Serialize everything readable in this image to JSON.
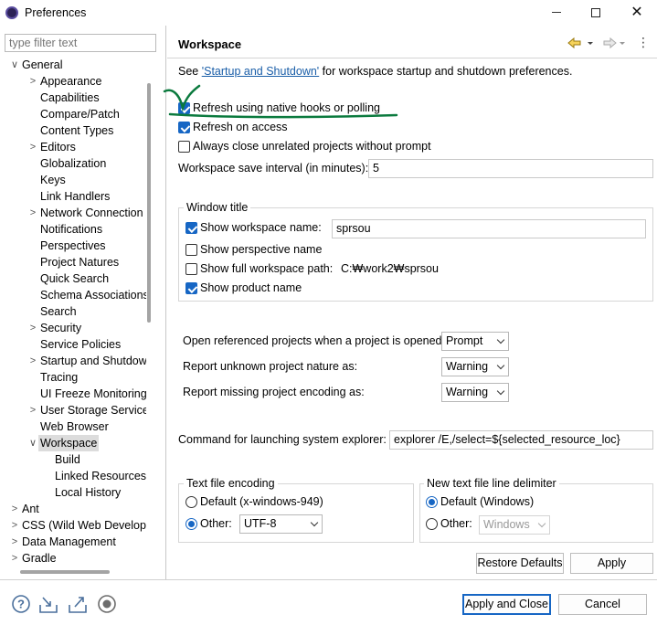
{
  "window": {
    "title": "Preferences",
    "controls": [
      "minimize",
      "maximize",
      "close"
    ]
  },
  "left": {
    "filter_placeholder": "type filter text",
    "tree": [
      {
        "label": "General",
        "twisty": "open",
        "level": 0
      },
      {
        "label": "Appearance",
        "twisty": "closed",
        "level": 1
      },
      {
        "label": "Capabilities",
        "twisty": "",
        "level": 1
      },
      {
        "label": "Compare/Patch",
        "twisty": "",
        "level": 1
      },
      {
        "label": "Content Types",
        "twisty": "",
        "level": 1
      },
      {
        "label": "Editors",
        "twisty": "closed",
        "level": 1
      },
      {
        "label": "Globalization",
        "twisty": "",
        "level": 1
      },
      {
        "label": "Keys",
        "twisty": "",
        "level": 1
      },
      {
        "label": "Link Handlers",
        "twisty": "",
        "level": 1
      },
      {
        "label": "Network Connection",
        "twisty": "closed",
        "level": 1
      },
      {
        "label": "Notifications",
        "twisty": "",
        "level": 1
      },
      {
        "label": "Perspectives",
        "twisty": "",
        "level": 1
      },
      {
        "label": "Project Natures",
        "twisty": "",
        "level": 1
      },
      {
        "label": "Quick Search",
        "twisty": "",
        "level": 1
      },
      {
        "label": "Schema Associations",
        "twisty": "",
        "level": 1
      },
      {
        "label": "Search",
        "twisty": "",
        "level": 1
      },
      {
        "label": "Security",
        "twisty": "closed",
        "level": 1
      },
      {
        "label": "Service Policies",
        "twisty": "",
        "level": 1
      },
      {
        "label": "Startup and Shutdow",
        "twisty": "closed",
        "level": 1
      },
      {
        "label": "Tracing",
        "twisty": "",
        "level": 1
      },
      {
        "label": "UI Freeze Monitoring",
        "twisty": "",
        "level": 1
      },
      {
        "label": "User Storage Service",
        "twisty": "closed",
        "level": 1
      },
      {
        "label": "Web Browser",
        "twisty": "",
        "level": 1
      },
      {
        "label": "Workspace",
        "twisty": "open",
        "level": 1,
        "selected": true
      },
      {
        "label": "Build",
        "twisty": "",
        "level": 2
      },
      {
        "label": "Linked Resources",
        "twisty": "",
        "level": 2
      },
      {
        "label": "Local History",
        "twisty": "",
        "level": 2
      },
      {
        "label": "Ant",
        "twisty": "closed",
        "level": 0
      },
      {
        "label": "CSS (Wild Web Develop",
        "twisty": "closed",
        "level": 0
      },
      {
        "label": "Data Management",
        "twisty": "closed",
        "level": 0
      },
      {
        "label": "Gradle",
        "twisty": "closed",
        "level": 0
      }
    ]
  },
  "page": {
    "title": "Workspace",
    "intro_prefix": "See ",
    "intro_link": "'Startup and Shutdown'",
    "intro_suffix": " for workspace startup and shutdown preferences.",
    "refresh_native": {
      "label": "Refresh using native hooks or polling",
      "checked": true
    },
    "refresh_access": {
      "label": "Refresh on access",
      "checked": true
    },
    "always_close": {
      "label": "Always close unrelated projects without prompt",
      "checked": false
    },
    "save_interval": {
      "label": "Workspace save interval (in minutes):",
      "value": "5"
    },
    "window_title": {
      "group_label": "Window title",
      "show_workspace_name": {
        "label": "Show workspace name:",
        "checked": true,
        "value": "sprsou"
      },
      "show_perspective_name": {
        "label": "Show perspective name",
        "checked": false
      },
      "show_full_path": {
        "label": "Show full workspace path:",
        "checked": false,
        "value": "C:₩work2₩sprsou"
      },
      "show_product_name": {
        "label": "Show product name",
        "checked": true
      }
    },
    "open_referenced": {
      "label": "Open referenced projects when a project is opened:",
      "value": "Prompt"
    },
    "unknown_nature": {
      "label": "Report unknown project nature as:",
      "value": "Warning"
    },
    "missing_encoding": {
      "label": "Report missing project encoding as:",
      "value": "Warning"
    },
    "explorer_command": {
      "label": "Command for launching system explorer:",
      "value": "explorer /E,/select=${selected_resource_loc}"
    },
    "text_encoding": {
      "group_label": "Text file encoding",
      "default_label": "Default (x-windows-949)",
      "other_label": "Other:",
      "other_value": "UTF-8",
      "selected": "other"
    },
    "line_delimiter": {
      "group_label": "New text file line delimiter",
      "default_label": "Default (Windows)",
      "other_label": "Other:",
      "other_value": "Windows",
      "selected": "default"
    },
    "restore_defaults": "Restore Defaults",
    "apply": "Apply"
  },
  "footer": {
    "icons": [
      "help-icon",
      "import-icon",
      "export-icon",
      "record-icon"
    ],
    "apply_close": "Apply and Close",
    "cancel": "Cancel"
  },
  "colors": {
    "accent": "#1666c4",
    "annotation": "#0b7a3e",
    "link": "#1a5ea8"
  }
}
